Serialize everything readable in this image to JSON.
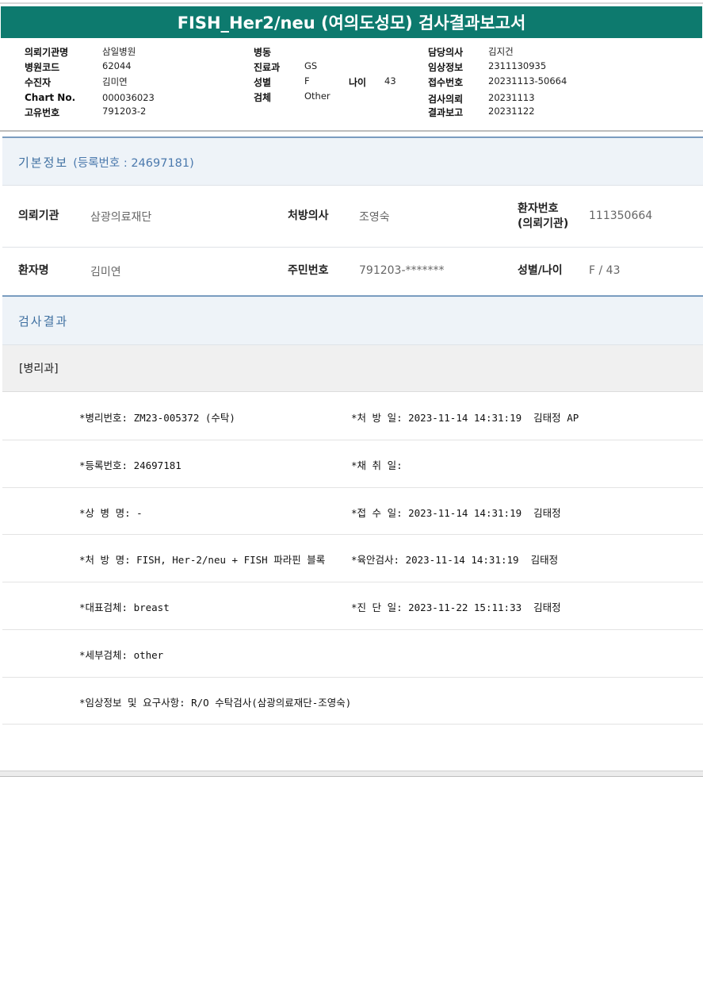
{
  "report": {
    "title": "FISH_Her2/neu (여의도성모) 검사결과보고서"
  },
  "header": {
    "left": [
      {
        "label": "의뢰기관명",
        "value": "삼일병원"
      },
      {
        "label": "병원코드",
        "value": "62044"
      },
      {
        "label": "수진자",
        "value": "김미연"
      },
      {
        "label": "Chart No.",
        "value": "000036023"
      },
      {
        "label": "고유번호",
        "value": "791203-2"
      }
    ],
    "middle": [
      {
        "label": "병동",
        "value": ""
      },
      {
        "label": "진료과",
        "value": "GS"
      },
      {
        "label": "성별",
        "value": "F"
      },
      {
        "label": "검체",
        "value": "Other"
      }
    ],
    "age": {
      "label": "나이",
      "value": "43"
    },
    "right": [
      {
        "label": "담당의사",
        "value": "김지건"
      },
      {
        "label": "임상정보",
        "value": "2311130935"
      },
      {
        "label": "접수번호",
        "value": "20231113-50664"
      },
      {
        "label": "검사의뢰",
        "value": "20231113"
      },
      {
        "label": "결과보고",
        "value": "20231122"
      }
    ]
  },
  "basic_info": {
    "heading": "기본정보",
    "reg_note": "(등록번호 : 24697181)",
    "row1": {
      "institution_label": "의뢰기관",
      "institution_value": "삼광의료재단",
      "doctor_label": "처방의사",
      "doctor_value": "조영숙",
      "patient_no_label_1": "환자번호",
      "patient_no_label_2": "(의뢰기관)",
      "patient_no_value": "111350664"
    },
    "row2": {
      "name_label": "환자명",
      "name_value": "김미연",
      "rrn_label": "주민번호",
      "rrn_value": "791203-*******",
      "sexage_label": "성별/나이",
      "sexage_value": "F / 43"
    }
  },
  "result": {
    "heading": "검사결과",
    "department": "[병리과]",
    "left_lines": [
      "*병리번호: ZM23-005372 (수탁)",
      "*등록번호: 24697181",
      "*상 병 명: -",
      "*처 방 명: FISH, Her-2/neu + FISH 파라핀 블록",
      "*대표검체: breast",
      "*세부검체: other",
      "*임상정보 및 요구사항: R/O 수탁검사(삼광의료재단-조영숙)"
    ],
    "right_lines": [
      "*처 방 일: 2023-11-14 14:31:19  김태정 AP",
      "*채 취 일:",
      "*접 수 일: 2023-11-14 14:31:19  김태정",
      "*육안검사: 2023-11-14 14:31:19  김태정",
      "*진 단 일: 2023-11-22 15:11:33  김태정"
    ]
  }
}
